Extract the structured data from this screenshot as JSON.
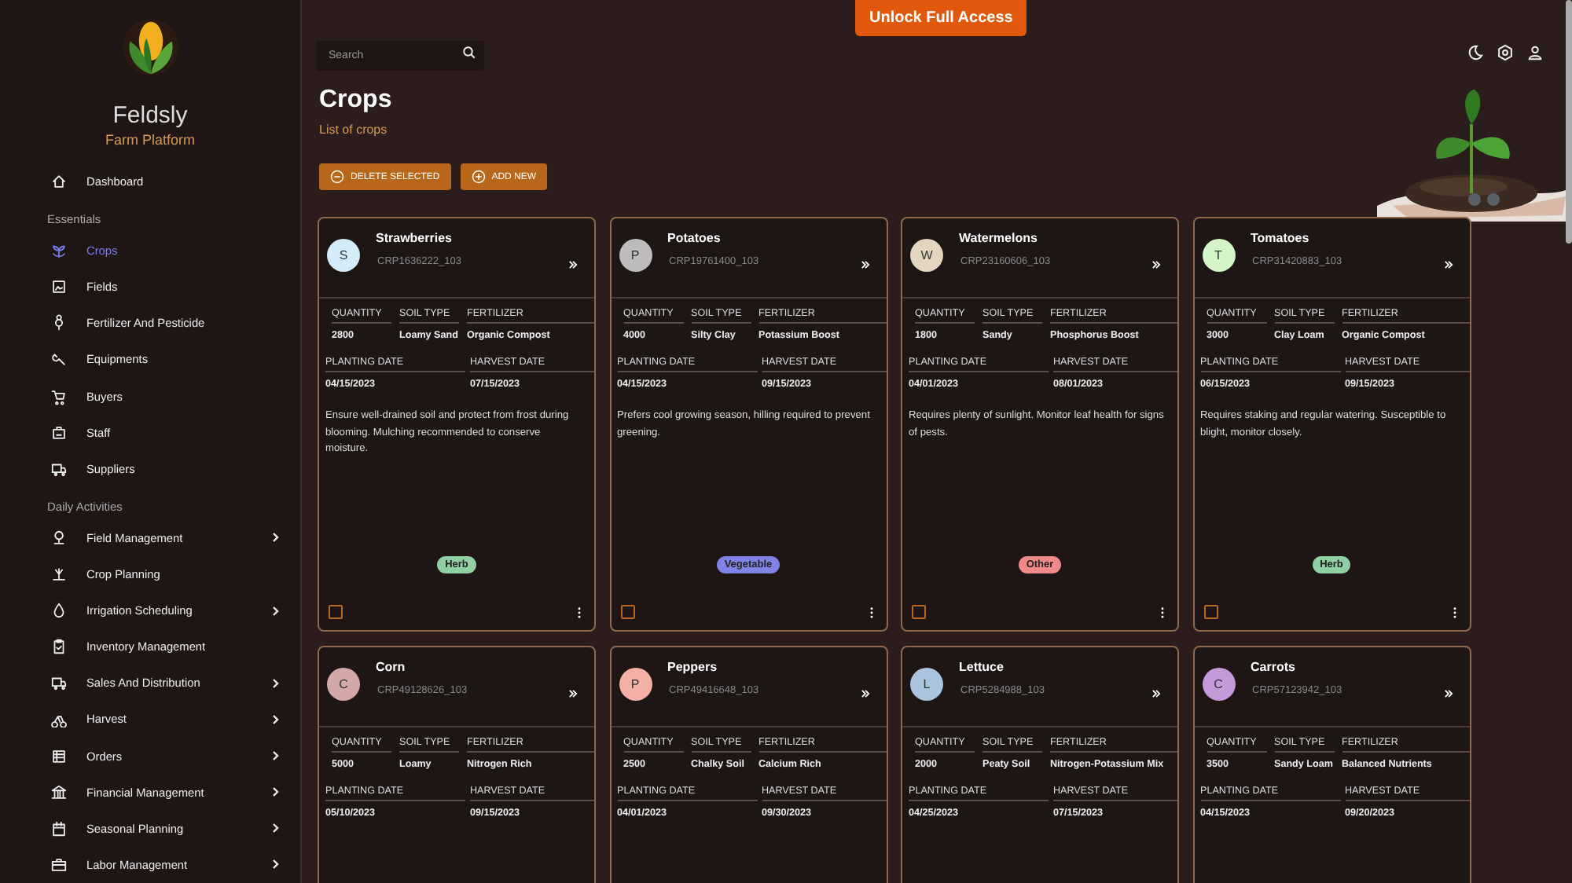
{
  "brand": {
    "name": "Feldsly",
    "tagline": "Farm Platform"
  },
  "sidebar": {
    "sections": [
      {
        "items": [
          {
            "label": "Dashboard",
            "selected": false,
            "has_submenu": false
          }
        ]
      },
      {
        "heading": "Essentials",
        "items": [
          {
            "label": "Crops",
            "selected": true,
            "has_submenu": false
          },
          {
            "label": "Fields",
            "selected": false,
            "has_submenu": false
          },
          {
            "label": "Fertilizer And Pesticide",
            "selected": false,
            "has_submenu": false
          },
          {
            "label": "Equipments",
            "selected": false,
            "has_submenu": false
          },
          {
            "label": "Buyers",
            "selected": false,
            "has_submenu": false
          },
          {
            "label": "Staff",
            "selected": false,
            "has_submenu": false
          },
          {
            "label": "Suppliers",
            "selected": false,
            "has_submenu": false
          }
        ]
      },
      {
        "heading": "Daily Activities",
        "items": [
          {
            "label": "Field Management",
            "selected": false,
            "has_submenu": true
          },
          {
            "label": "Crop Planning",
            "selected": false,
            "has_submenu": false
          },
          {
            "label": "Irrigation Scheduling",
            "selected": false,
            "has_submenu": true
          },
          {
            "label": "Inventory Management",
            "selected": false,
            "has_submenu": false
          },
          {
            "label": "Sales And Distribution",
            "selected": false,
            "has_submenu": true
          },
          {
            "label": "Harvest",
            "selected": false,
            "has_submenu": true
          },
          {
            "label": "Orders",
            "selected": false,
            "has_submenu": true
          },
          {
            "label": "Financial Management",
            "selected": false,
            "has_submenu": true
          },
          {
            "label": "Seasonal Planning",
            "selected": false,
            "has_submenu": true
          },
          {
            "label": "Labor Management",
            "selected": false,
            "has_submenu": true
          }
        ]
      }
    ]
  },
  "banner_button": "Unlock Full Access",
  "search": {
    "placeholder": "Search"
  },
  "page": {
    "title": "Crops",
    "subtitle": "List of crops"
  },
  "actions": [
    {
      "kind": "delete",
      "label": "DELETE SELECTED"
    },
    {
      "kind": "add",
      "label": "ADD NEW"
    }
  ],
  "crops": [
    {
      "avatar": {
        "initial": "S",
        "color": "#d4ecfa"
      },
      "name": "Strawberries",
      "code": "CRP1636222_103",
      "stats": [
        {
          "label": "QUANTITY",
          "value": "2800"
        },
        {
          "label": "SOIL TYPE",
          "value": "Loamy Sand"
        },
        {
          "label": "FERTILIZER",
          "value": "Organic Compost"
        }
      ],
      "dates": [
        {
          "label": "PLANTING DATE",
          "value": "04/15/2023"
        },
        {
          "label": "HARVEST DATE",
          "value": "07/15/2023"
        }
      ],
      "notes": "Ensure well-drained soil and protect from frost during blooming. Mulching recommended to conserve moisture.",
      "tag": {
        "label": "Herb",
        "color": "#8fcfa3"
      },
      "checked": false
    },
    {
      "avatar": {
        "initial": "P",
        "color": "#bdbbbb"
      },
      "name": "Potatoes",
      "code": "CRP19761400_103",
      "stats": [
        {
          "label": "QUANTITY",
          "value": "4000"
        },
        {
          "label": "SOIL TYPE",
          "value": "Silty Clay"
        },
        {
          "label": "FERTILIZER",
          "value": "Potassium Boost"
        }
      ],
      "dates": [
        {
          "label": "PLANTING DATE",
          "value": "04/15/2023"
        },
        {
          "label": "HARVEST DATE",
          "value": "09/15/2023"
        }
      ],
      "notes": "Prefers cool growing season, hilling required to prevent greening.",
      "tag": {
        "label": "Vegetable",
        "color": "#7f83e6"
      },
      "checked": false
    },
    {
      "avatar": {
        "initial": "W",
        "color": "#e2d6c0"
      },
      "name": "Watermelons",
      "code": "CRP23160606_103",
      "stats": [
        {
          "label": "QUANTITY",
          "value": "1800"
        },
        {
          "label": "SOIL TYPE",
          "value": "Sandy"
        },
        {
          "label": "FERTILIZER",
          "value": "Phosphorus Boost"
        }
      ],
      "dates": [
        {
          "label": "PLANTING DATE",
          "value": "04/01/2023"
        },
        {
          "label": "HARVEST DATE",
          "value": "08/01/2023"
        }
      ],
      "notes": "Requires plenty of sunlight. Monitor leaf health for signs of pests.",
      "tag": {
        "label": "Other",
        "color": "#f08a8a"
      },
      "checked": false
    },
    {
      "avatar": {
        "initial": "T",
        "color": "#d4f5c8"
      },
      "name": "Tomatoes",
      "code": "CRP31420883_103",
      "stats": [
        {
          "label": "QUANTITY",
          "value": "3000"
        },
        {
          "label": "SOIL TYPE",
          "value": "Clay Loam"
        },
        {
          "label": "FERTILIZER",
          "value": "Organic Compost"
        }
      ],
      "dates": [
        {
          "label": "PLANTING DATE",
          "value": "06/15/2023"
        },
        {
          "label": "HARVEST DATE",
          "value": "09/15/2023"
        }
      ],
      "notes": "Requires staking and regular watering. Susceptible to blight, monitor closely.",
      "tag": {
        "label": "Herb",
        "color": "#8fcfa3"
      },
      "checked": false
    },
    {
      "avatar": {
        "initial": "C",
        "color": "#d4a8a6"
      },
      "name": "Corn",
      "code": "CRP49128626_103",
      "stats": [
        {
          "label": "QUANTITY",
          "value": "5000"
        },
        {
          "label": "SOIL TYPE",
          "value": "Loamy"
        },
        {
          "label": "FERTILIZER",
          "value": "Nitrogen Rich"
        }
      ],
      "dates": [
        {
          "label": "PLANTING DATE",
          "value": "05/10/2023"
        },
        {
          "label": "HARVEST DATE",
          "value": "09/15/2023"
        }
      ]
    },
    {
      "avatar": {
        "initial": "P",
        "color": "#f3b0a4"
      },
      "name": "Peppers",
      "code": "CRP49416648_103",
      "stats": [
        {
          "label": "QUANTITY",
          "value": "2500"
        },
        {
          "label": "SOIL TYPE",
          "value": "Chalky Soil"
        },
        {
          "label": "FERTILIZER",
          "value": "Calcium Rich"
        }
      ],
      "dates": [
        {
          "label": "PLANTING DATE",
          "value": "04/01/2023"
        },
        {
          "label": "HARVEST DATE",
          "value": "09/30/2023"
        }
      ]
    },
    {
      "avatar": {
        "initial": "L",
        "color": "#a9c4de"
      },
      "name": "Lettuce",
      "code": "CRP5284988_103",
      "stats": [
        {
          "label": "QUANTITY",
          "value": "2000"
        },
        {
          "label": "SOIL TYPE",
          "value": "Peaty Soil"
        },
        {
          "label": "FERTILIZER",
          "value": "Nitrogen-Potassium Mix"
        }
      ],
      "dates": [
        {
          "label": "PLANTING DATE",
          "value": "04/25/2023"
        },
        {
          "label": "HARVEST DATE",
          "value": "07/15/2023"
        }
      ]
    },
    {
      "avatar": {
        "initial": "C",
        "color": "#c49ad8"
      },
      "name": "Carrots",
      "code": "CRP57123942_103",
      "stats": [
        {
          "label": "QUANTITY",
          "value": "3500"
        },
        {
          "label": "SOIL TYPE",
          "value": "Sandy Loam"
        },
        {
          "label": "FERTILIZER",
          "value": "Balanced Nutrients"
        }
      ],
      "dates": [
        {
          "label": "PLANTING DATE",
          "value": "04/15/2023"
        },
        {
          "label": "HARVEST DATE",
          "value": "09/20/2023"
        }
      ]
    }
  ]
}
